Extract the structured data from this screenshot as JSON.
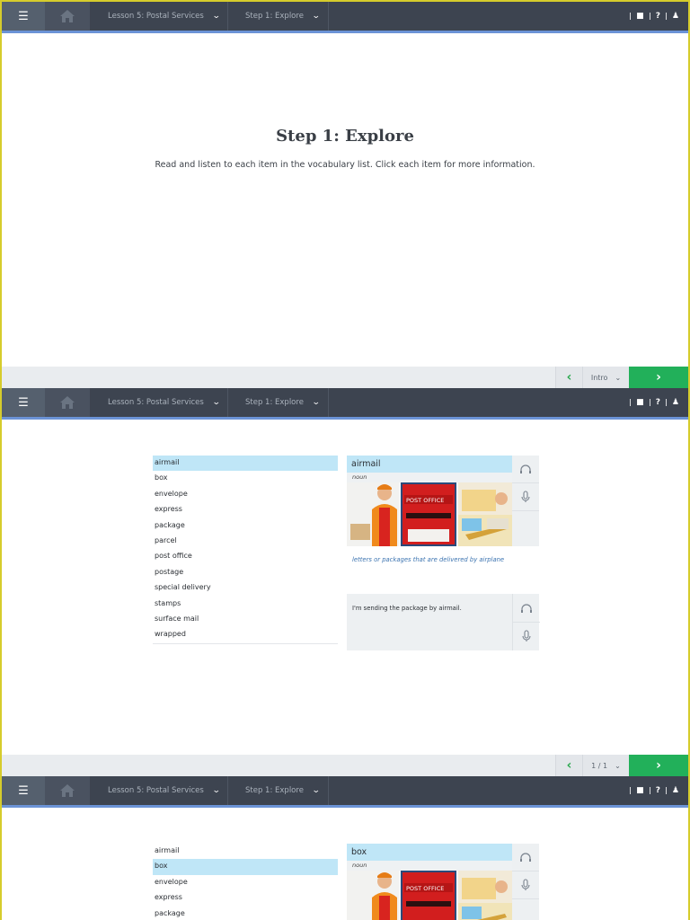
{
  "topbar": {
    "lesson_label": "Lesson 5: Postal Services",
    "step_label": "Step 1: Explore"
  },
  "intro": {
    "title": "Step 1: Explore",
    "instructions": "Read and listen to each item in the vocabulary list. Click each item for more information."
  },
  "nav": {
    "intro_select": "Intro",
    "page_select": "1 / 1"
  },
  "vocab": {
    "items": [
      "airmail",
      "box",
      "envelope",
      "express",
      "package",
      "parcel",
      "post office",
      "postage",
      "special delivery",
      "stamps",
      "surface mail",
      "wrapped"
    ],
    "items_partial": [
      "airmail",
      "box",
      "envelope",
      "express",
      "package"
    ]
  },
  "detail1": {
    "word": "airmail",
    "pos": "noun",
    "definition": "letters or packages that are delivered by airplane",
    "example": "I'm sending the package by airmail.",
    "post_office_sign": "POST OFFICE"
  },
  "detail2": {
    "word": "box",
    "pos": "noun",
    "post_office_sign": "POST OFFICE"
  },
  "colors": {
    "topbar": "#3d4450",
    "accent_blue": "#6b93d6",
    "next_green": "#22b05a",
    "highlight": "#bfe6f7"
  }
}
